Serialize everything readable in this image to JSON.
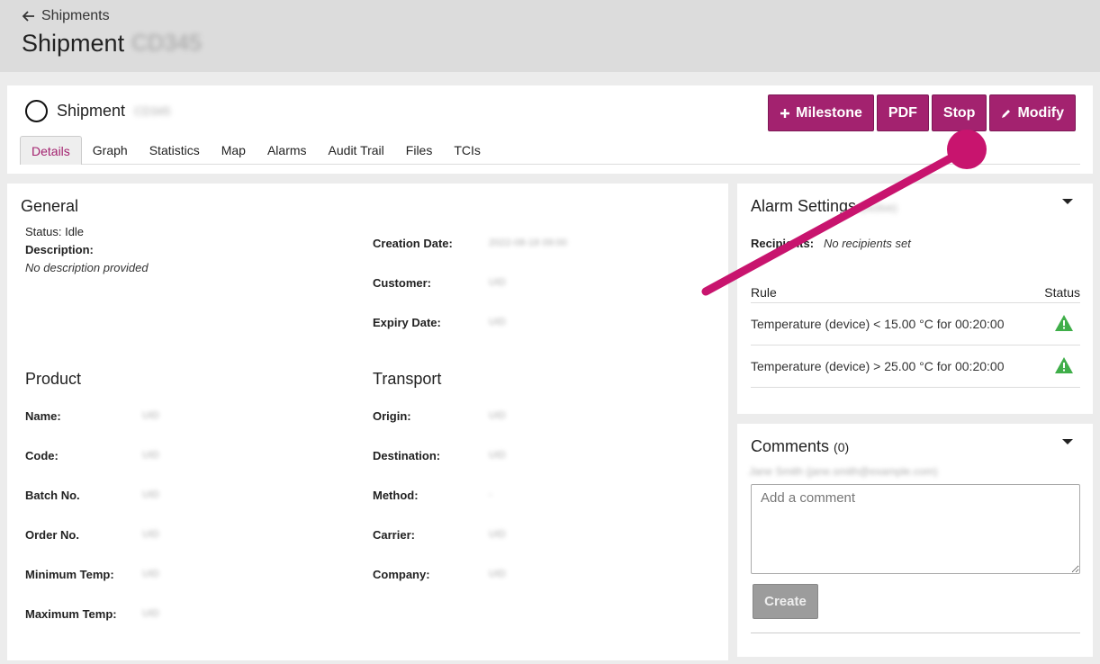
{
  "nav": {
    "back_label": "Shipments"
  },
  "header": {
    "title": "Shipment",
    "title_id_blurred": "CD345"
  },
  "shipment": {
    "name": "Shipment",
    "id_blurred": "CD345"
  },
  "actions": {
    "milestone": "Milestone",
    "pdf": "PDF",
    "stop": "Stop",
    "modify": "Modify"
  },
  "tabs": [
    "Details",
    "Graph",
    "Statistics",
    "Map",
    "Alarms",
    "Audit Trail",
    "Files",
    "TCIs"
  ],
  "general": {
    "title": "General",
    "status": "Status: Idle",
    "description_label": "Description:",
    "description_value": "No description provided",
    "creation_date_label": "Creation Date:",
    "creation_date_value": "2022-08-18 09:00",
    "customer_label": "Customer:",
    "customer_value": "UID",
    "expiry_label": "Expiry Date:",
    "expiry_value": "UID"
  },
  "product": {
    "title": "Product",
    "fields": [
      {
        "label": "Name:",
        "value": "UID"
      },
      {
        "label": "Code:",
        "value": "UID"
      },
      {
        "label": "Batch No.",
        "value": "UID"
      },
      {
        "label": "Order No.",
        "value": "UID"
      },
      {
        "label": "Minimum Temp:",
        "value": "UID"
      },
      {
        "label": "Maximum Temp:",
        "value": "UID"
      }
    ]
  },
  "transport": {
    "title": "Transport",
    "fields": [
      {
        "label": "Origin:",
        "value": "UID"
      },
      {
        "label": "Destination:",
        "value": "UID"
      },
      {
        "label": "Method:",
        "value": "-"
      },
      {
        "label": "Carrier:",
        "value": "UID"
      },
      {
        "label": "Company:",
        "value": "UID"
      }
    ]
  },
  "alarm_settings": {
    "title": "Alarm Settings",
    "title_blurred": "(Active)",
    "recipients_label": "Recipients:",
    "recipients_value": "No recipients set",
    "col_rule": "Rule",
    "col_status": "Status",
    "rules": [
      {
        "rule": "Temperature (device) < 15.00 °C for 00:20:00",
        "status_icon": "warning-icon"
      },
      {
        "rule": "Temperature (device) > 25.00 °C for 00:20:00",
        "status_icon": "warning-icon"
      }
    ]
  },
  "comments": {
    "title": "Comments",
    "count": "(0)",
    "user_blurred": "Jane Smith (jane.smith@example.com)",
    "placeholder": "Add a comment",
    "create_label": "Create"
  },
  "colors": {
    "accent": "#a3226f",
    "warning": "#3fae49",
    "topbar": "#dcdcdc"
  }
}
